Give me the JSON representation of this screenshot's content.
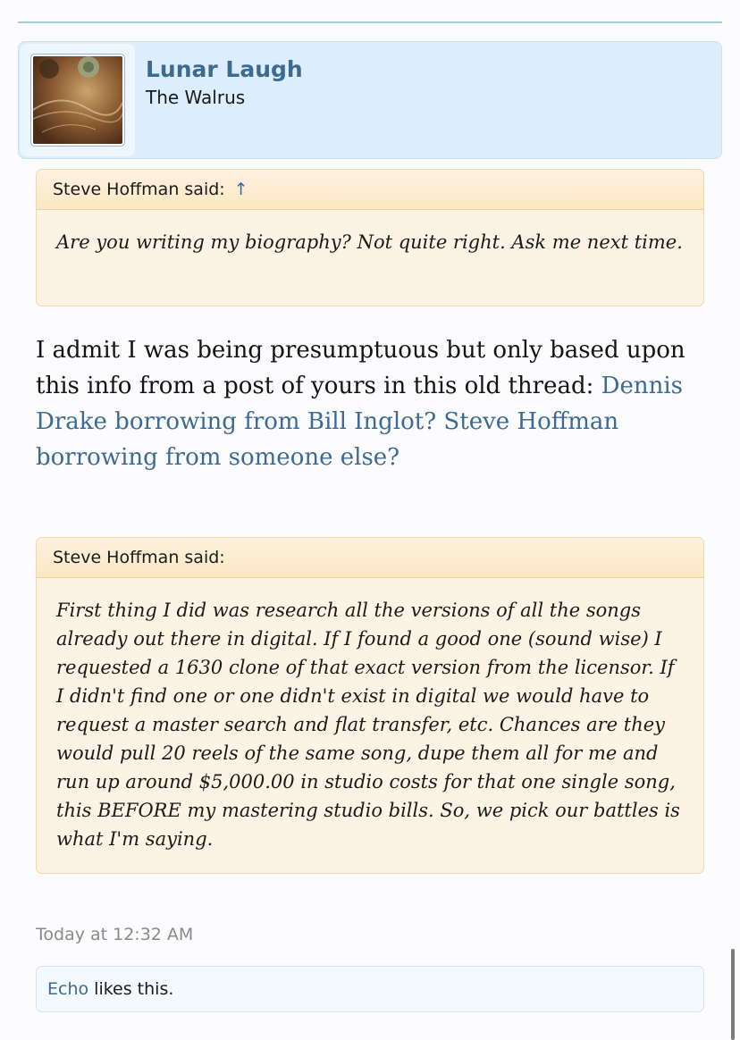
{
  "user": {
    "name": "Lunar Laugh",
    "title": "The Walrus",
    "avatar_icon": "album-cover-avatar"
  },
  "quote1": {
    "author": "Steve Hoffman said:",
    "jump_arrow": "↑",
    "text": "Are you writing my biography? Not quite right. Ask me next time."
  },
  "post": {
    "text": "I admit I was being presumptuous but only based upon this info from a post of yours in this old thread:",
    "link_text": "Dennis Drake borrowing from Bill Inglot? Steve Hoffman borrowing from someone else?"
  },
  "quote2": {
    "author": "Steve Hoffman said:",
    "text": "First thing I did was research all the versions of all the songs already out there in digital. If I found a good one (sound wise) I requested a 1630 clone of that exact version from the licensor. If I didn't find one or one didn't exist in digital we would have to request a master search and flat transfer, etc. Chances are they would pull 20 reels of the same song, dupe them all for me and run up around $5,000.00 in studio costs for that one single song, this BEFORE my mastering studio bills. So, we pick our battles is what I'm saying."
  },
  "meta": {
    "date": "Today at 12:32 AM"
  },
  "likes": {
    "liker": "Echo",
    "suffix": " likes this."
  },
  "colors": {
    "link": "#3c6a93",
    "card_bg": "#dceefb",
    "quote_bg": "#fdf3e4"
  }
}
